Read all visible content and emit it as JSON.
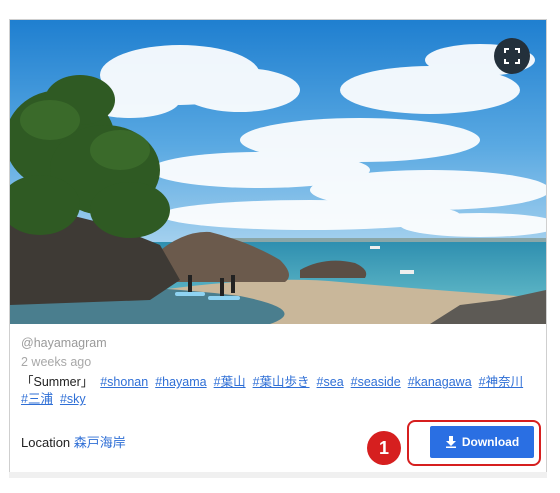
{
  "post": {
    "username": "@hayamagram",
    "time_ago": "2 weeks ago",
    "caption_title": "「Summer」",
    "hashtags": [
      "#shonan",
      "#hayama",
      "#葉山",
      "#葉山歩き",
      "#sea",
      "#seaside",
      "#kanagawa",
      "#神奈川",
      "#三浦",
      "#sky"
    ],
    "location_label": "Location",
    "location_name": "森戸海岸"
  },
  "actions": {
    "download_label": "Download",
    "annotation_number": "1"
  },
  "icons": {
    "expand": "expand-fullscreen-icon",
    "download": "download-icon"
  },
  "colors": {
    "link": "#2f6fd6",
    "button": "#2a6fe3",
    "highlight": "#d61f1f"
  }
}
